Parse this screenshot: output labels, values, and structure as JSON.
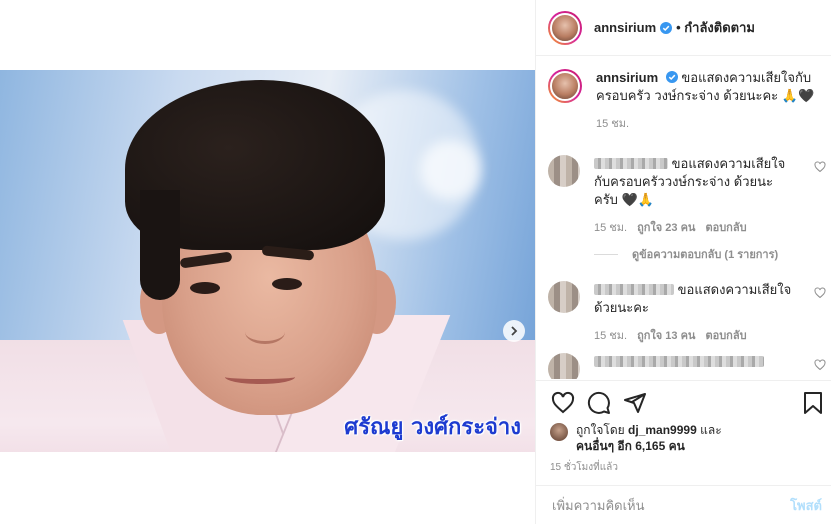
{
  "header": {
    "username": "annsirium",
    "follow_state": "• กำลังติดตาม"
  },
  "media": {
    "caption_text": "ศรัณยู วงศ์กระจ่าง"
  },
  "post": {
    "username": "annsirium",
    "caption": "ขอแสดงความเสียใจกับครอบครัว วงษ์กระจ่าง ด้วยนะคะ 🙏🖤",
    "time": "15 ชม."
  },
  "comments": [
    {
      "text": "ขอแสดงความเสียใจกับครอบครัววงษ์กระจ่าง ด้วยนะครับ 🖤🙏",
      "time": "15 ชม.",
      "likes": "ถูกใจ 23 คน",
      "reply": "ตอบกลับ"
    },
    {
      "text": "ขอแสดงความเสียใจด้วยนะคะ",
      "time": "15 ชม.",
      "likes": "ถูกใจ 13 คน",
      "reply": "ตอบกลับ"
    }
  ],
  "view_replies": "ดูข้อความตอบกลับ (1 รายการ)",
  "likes": {
    "prefix": "ถูกใจโดย",
    "user": "dj_man9999",
    "and": "และ",
    "others": "คนอื่นๆ อีก 6,165 คน"
  },
  "timestamp": "15 ชั่วโมงที่แล้ว",
  "add_comment": {
    "placeholder": "เพิ่มความคิดเห็น",
    "post_label": "โพสต์"
  },
  "colors": {
    "verified": "#3897f0",
    "caption": "#1d3bd0",
    "post_button": "#b2dffc"
  }
}
